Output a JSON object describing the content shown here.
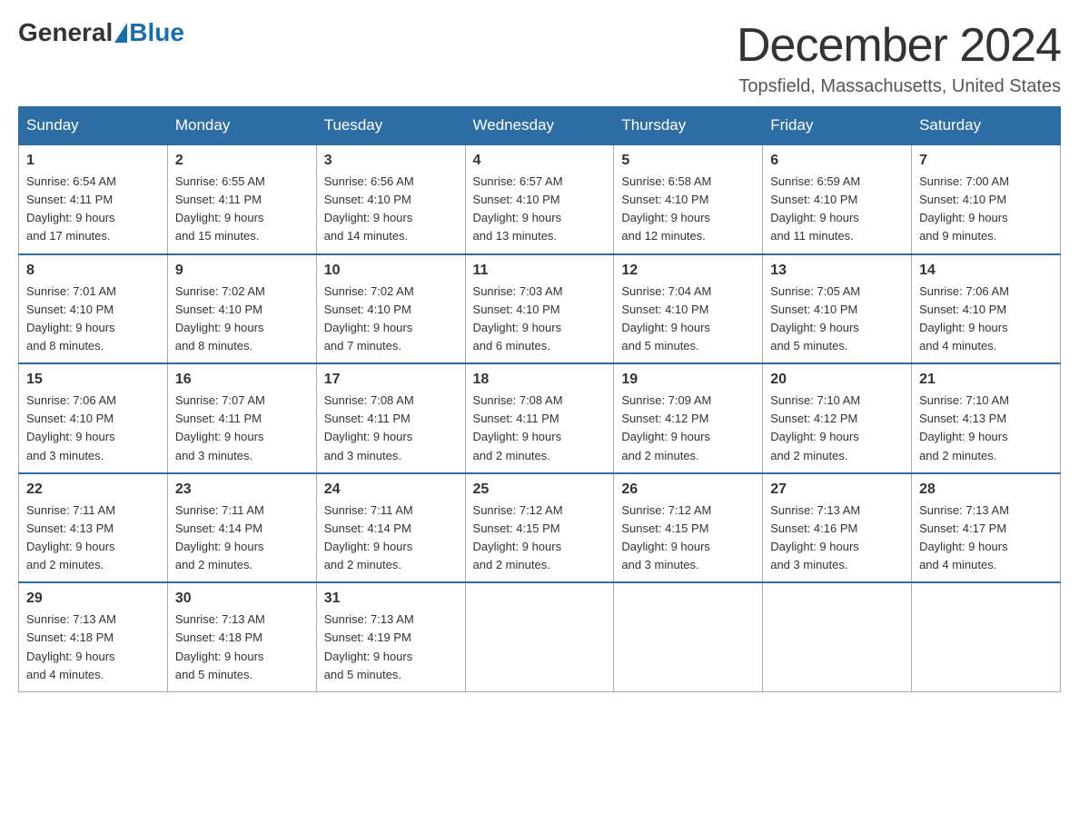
{
  "header": {
    "logo_general": "General",
    "logo_blue": "Blue",
    "month_title": "December 2024",
    "location": "Topsfield, Massachusetts, United States"
  },
  "weekdays": [
    "Sunday",
    "Monday",
    "Tuesday",
    "Wednesday",
    "Thursday",
    "Friday",
    "Saturday"
  ],
  "weeks": [
    [
      {
        "day": "1",
        "sunrise": "6:54 AM",
        "sunset": "4:11 PM",
        "daylight": "9 hours and 17 minutes."
      },
      {
        "day": "2",
        "sunrise": "6:55 AM",
        "sunset": "4:11 PM",
        "daylight": "9 hours and 15 minutes."
      },
      {
        "day": "3",
        "sunrise": "6:56 AM",
        "sunset": "4:10 PM",
        "daylight": "9 hours and 14 minutes."
      },
      {
        "day": "4",
        "sunrise": "6:57 AM",
        "sunset": "4:10 PM",
        "daylight": "9 hours and 13 minutes."
      },
      {
        "day": "5",
        "sunrise": "6:58 AM",
        "sunset": "4:10 PM",
        "daylight": "9 hours and 12 minutes."
      },
      {
        "day": "6",
        "sunrise": "6:59 AM",
        "sunset": "4:10 PM",
        "daylight": "9 hours and 11 minutes."
      },
      {
        "day": "7",
        "sunrise": "7:00 AM",
        "sunset": "4:10 PM",
        "daylight": "9 hours and 9 minutes."
      }
    ],
    [
      {
        "day": "8",
        "sunrise": "7:01 AM",
        "sunset": "4:10 PM",
        "daylight": "9 hours and 8 minutes."
      },
      {
        "day": "9",
        "sunrise": "7:02 AM",
        "sunset": "4:10 PM",
        "daylight": "9 hours and 8 minutes."
      },
      {
        "day": "10",
        "sunrise": "7:02 AM",
        "sunset": "4:10 PM",
        "daylight": "9 hours and 7 minutes."
      },
      {
        "day": "11",
        "sunrise": "7:03 AM",
        "sunset": "4:10 PM",
        "daylight": "9 hours and 6 minutes."
      },
      {
        "day": "12",
        "sunrise": "7:04 AM",
        "sunset": "4:10 PM",
        "daylight": "9 hours and 5 minutes."
      },
      {
        "day": "13",
        "sunrise": "7:05 AM",
        "sunset": "4:10 PM",
        "daylight": "9 hours and 5 minutes."
      },
      {
        "day": "14",
        "sunrise": "7:06 AM",
        "sunset": "4:10 PM",
        "daylight": "9 hours and 4 minutes."
      }
    ],
    [
      {
        "day": "15",
        "sunrise": "7:06 AM",
        "sunset": "4:10 PM",
        "daylight": "9 hours and 3 minutes."
      },
      {
        "day": "16",
        "sunrise": "7:07 AM",
        "sunset": "4:11 PM",
        "daylight": "9 hours and 3 minutes."
      },
      {
        "day": "17",
        "sunrise": "7:08 AM",
        "sunset": "4:11 PM",
        "daylight": "9 hours and 3 minutes."
      },
      {
        "day": "18",
        "sunrise": "7:08 AM",
        "sunset": "4:11 PM",
        "daylight": "9 hours and 2 minutes."
      },
      {
        "day": "19",
        "sunrise": "7:09 AM",
        "sunset": "4:12 PM",
        "daylight": "9 hours and 2 minutes."
      },
      {
        "day": "20",
        "sunrise": "7:10 AM",
        "sunset": "4:12 PM",
        "daylight": "9 hours and 2 minutes."
      },
      {
        "day": "21",
        "sunrise": "7:10 AM",
        "sunset": "4:13 PM",
        "daylight": "9 hours and 2 minutes."
      }
    ],
    [
      {
        "day": "22",
        "sunrise": "7:11 AM",
        "sunset": "4:13 PM",
        "daylight": "9 hours and 2 minutes."
      },
      {
        "day": "23",
        "sunrise": "7:11 AM",
        "sunset": "4:14 PM",
        "daylight": "9 hours and 2 minutes."
      },
      {
        "day": "24",
        "sunrise": "7:11 AM",
        "sunset": "4:14 PM",
        "daylight": "9 hours and 2 minutes."
      },
      {
        "day": "25",
        "sunrise": "7:12 AM",
        "sunset": "4:15 PM",
        "daylight": "9 hours and 2 minutes."
      },
      {
        "day": "26",
        "sunrise": "7:12 AM",
        "sunset": "4:15 PM",
        "daylight": "9 hours and 3 minutes."
      },
      {
        "day": "27",
        "sunrise": "7:13 AM",
        "sunset": "4:16 PM",
        "daylight": "9 hours and 3 minutes."
      },
      {
        "day": "28",
        "sunrise": "7:13 AM",
        "sunset": "4:17 PM",
        "daylight": "9 hours and 4 minutes."
      }
    ],
    [
      {
        "day": "29",
        "sunrise": "7:13 AM",
        "sunset": "4:18 PM",
        "daylight": "9 hours and 4 minutes."
      },
      {
        "day": "30",
        "sunrise": "7:13 AM",
        "sunset": "4:18 PM",
        "daylight": "9 hours and 5 minutes."
      },
      {
        "day": "31",
        "sunrise": "7:13 AM",
        "sunset": "4:19 PM",
        "daylight": "9 hours and 5 minutes."
      },
      null,
      null,
      null,
      null
    ]
  ],
  "labels": {
    "sunrise": "Sunrise:",
    "sunset": "Sunset:",
    "daylight": "Daylight:"
  }
}
